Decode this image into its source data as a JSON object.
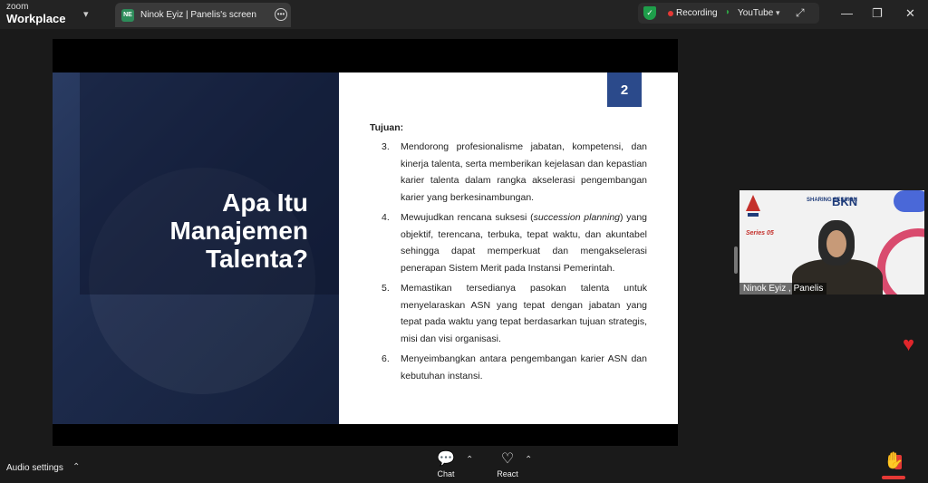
{
  "app": {
    "brand_line1": "zoom",
    "brand_line2": "Workplace"
  },
  "tab": {
    "badge": "NE",
    "title": "Ninok Eyiz | Panelis's screen"
  },
  "recording": {
    "status_label": "Recording",
    "stream_label": "YouTube"
  },
  "colors": {
    "slide_accent": "#2b4a8b",
    "recording_dot": "#e53935",
    "shield": "#1e9e4a"
  },
  "slide": {
    "title_lines": [
      "Apa Itu",
      "Manajemen",
      "Talenta?"
    ],
    "page_number": "2",
    "heading": "Tujuan:",
    "items": [
      {
        "num": "3.",
        "text": "Mendorong profesionalisme jabatan, kompetensi, dan kinerja talenta, serta memberikan kejelasan dan kepastian karier talenta dalam rangka akselerasi pengembangan karier yang berkesinambungan."
      },
      {
        "num": "4.",
        "text_before": "Mewujudkan rencana suksesi (",
        "text_italic": "succession planning",
        "text_after": ") yang objektif, terencana, terbuka, tepat waktu, dan akuntabel sehingga dapat memperkuat dan mengakselerasi penerapan Sistem Merit pada Instansi Pemerintah."
      },
      {
        "num": "5.",
        "text": "Memastikan tersedianya pasokan talenta untuk menyelaraskan ASN yang tepat dengan jabatan yang tepat pada waktu yang tepat berdasarkan tujuan strategis, misi dan visi organisasi."
      },
      {
        "num": "6.",
        "text": "Menyeimbangkan antara pengembangan karier ASN dan kebutuhan instansi."
      }
    ]
  },
  "participant": {
    "name": "Ninok Eyiz , Panelis",
    "bg_sharing": "SHARING SESSION",
    "bg_bkn": "BKN",
    "bg_series": "Series 05"
  },
  "bottombar": {
    "audio_label": "Audio settings",
    "chat_label": "Chat",
    "react_label": "React"
  },
  "icons": {
    "caret_down": "▾",
    "caret_up": "⌃",
    "expand": "⤢",
    "minimize": "—",
    "restore": "❐",
    "close": "✕",
    "more": "•••",
    "shield": "✓",
    "signal": "◗",
    "heart": "♥",
    "chat": "💬",
    "react": "♡",
    "raise_hand": "✋"
  }
}
